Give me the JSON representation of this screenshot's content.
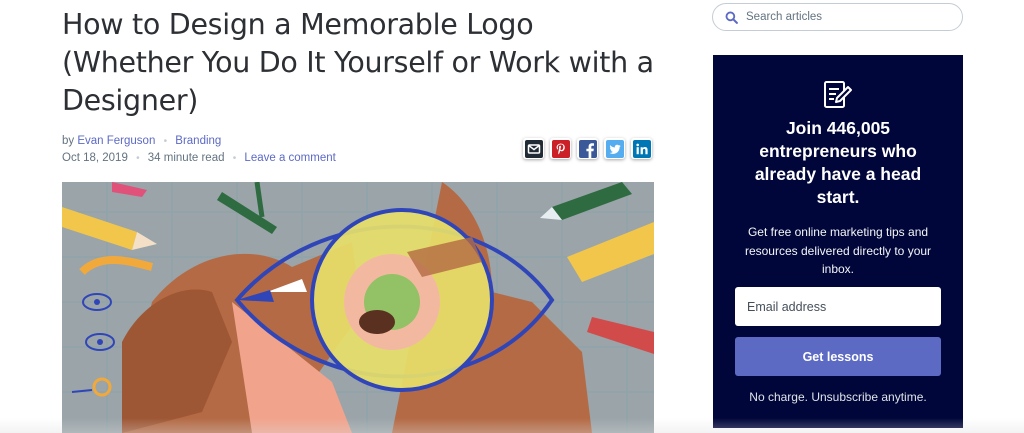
{
  "article": {
    "title": "How to Design a Memorable Logo (Whether You Do It Yourself or Work with a Designer)",
    "by_prefix": "by",
    "author": "Evan Ferguson",
    "category": "Branding",
    "date": "Oct 18, 2019",
    "read_time": "34 minute read",
    "comment_link": "Leave a comment",
    "separator": "•"
  },
  "share": {
    "icons": [
      "email-icon",
      "pinterest-icon",
      "facebook-icon",
      "twitter-icon",
      "linkedin-icon"
    ],
    "colors": {
      "email": "#212b36",
      "pinterest": "#cb2027",
      "facebook": "#3b5998",
      "twitter": "#55acee",
      "linkedin": "#0077b5"
    }
  },
  "hero": {
    "illustration": "eye-magnifier-design-tools",
    "colors": {
      "background": "#9aa4a9",
      "skin": "#b46a44",
      "eye_outline": "#3046b8",
      "lens": "#e7e06a",
      "pencil_yellow": "#f2c64a",
      "pencil_red": "#d24b4b"
    }
  },
  "search": {
    "placeholder": "Search articles",
    "icon": "search-icon"
  },
  "promo": {
    "icon": "pencil-notepad-icon",
    "heading": "Join 446,005 entrepreneurs who already have a head start.",
    "description": "Get free online marketing tips and resources delivered directly to your inbox.",
    "email_placeholder": "Email address",
    "button_label": "Get lessons",
    "note": "No charge. Unsubscribe anytime.",
    "colors": {
      "background": "#000639",
      "button": "#5c6ac4"
    }
  }
}
